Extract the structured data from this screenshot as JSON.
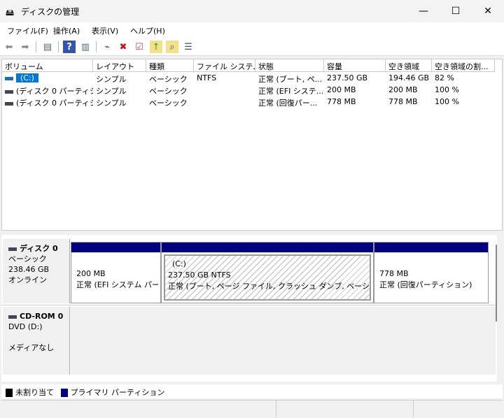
{
  "window": {
    "title": "ディスクの管理",
    "minimize": "—",
    "maximize": "☐",
    "close": "✕"
  },
  "menu": [
    "ファイル(F)",
    "操作(A)",
    "表示(V)",
    "ヘルプ(H)"
  ],
  "toolbar": [
    "back-icon",
    "forward-icon",
    "console-tree-icon",
    "help-icon",
    "action-pane-icon",
    "connect-disk-icon",
    "delete-icon",
    "check-icon",
    "folder-up-icon",
    "folder-search-icon",
    "properties-icon"
  ],
  "volumes": {
    "columns": [
      "ボリューム",
      "レイアウト",
      "種類",
      "ファイル システム",
      "状態",
      "容量",
      "空き領域",
      "空き領域の割..."
    ],
    "rows": [
      [
        "(C:)",
        "シンプル",
        "ベーシック",
        "NTFS",
        "正常 (ブート, ペ...",
        "237.50 GB",
        "194.46 GB",
        "82 %"
      ],
      [
        "(ディスク 0 パーティシ...",
        "シンプル",
        "ベーシック",
        "",
        "正常 (EFI システ...",
        "200 MB",
        "200 MB",
        "100 %"
      ],
      [
        "(ディスク 0 パーティシ...",
        "シンプル",
        "ベーシック",
        "",
        "正常 (回復パー...",
        "778 MB",
        "778 MB",
        "100 %"
      ]
    ]
  },
  "disks": [
    {
      "name": "ディスク 0",
      "type": "ベーシック",
      "size": "238.46 GB",
      "status": "オンライン",
      "partitions": [
        {
          "label": "",
          "size": "200 MB",
          "status": "正常 (EFI システム パーテ"
        },
        {
          "label": "(C:)",
          "size": "237.50 GB NTFS",
          "status": "正常 (ブート, ページ ファイル, クラッシュ ダンプ, ベーシック データ"
        },
        {
          "label": "",
          "size": "778 MB",
          "status": "正常 (回復パーティション)"
        }
      ]
    },
    {
      "name": "CD-ROM 0",
      "type": "DVD (D:)",
      "status": "メディアなし"
    }
  ],
  "legend": [
    {
      "label": "未割り当て",
      "color": "#000000"
    },
    {
      "label": "プライマリ パーティション",
      "color": "#000080"
    }
  ],
  "colors": {
    "primary": "#000080",
    "selection": "#0078d7"
  }
}
